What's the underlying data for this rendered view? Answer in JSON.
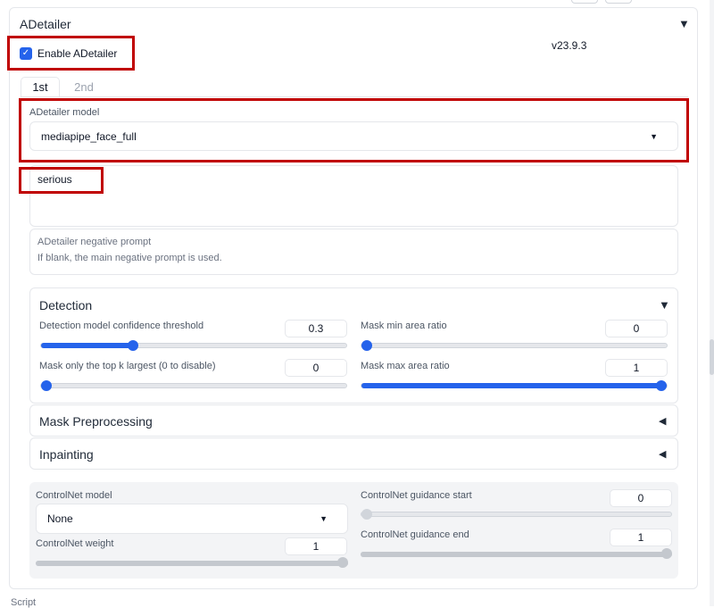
{
  "panel": {
    "title": "ADetailer",
    "version": "v23.9.3"
  },
  "enable": {
    "label": "Enable ADetailer",
    "checked": true
  },
  "tabs": [
    {
      "label": "1st",
      "active": true
    },
    {
      "label": "2nd",
      "active": false
    }
  ],
  "model": {
    "label": "ADetailer model",
    "value": "mediapipe_face_full"
  },
  "prompt": {
    "value": "serious"
  },
  "negative_prompt": {
    "placeholder_line1": "ADetailer negative prompt",
    "placeholder_line2": "If blank, the main negative prompt is used."
  },
  "detection": {
    "title": "Detection",
    "confidence": {
      "label": "Detection model confidence threshold",
      "value": "0.3",
      "fraction": 0.3
    },
    "topk": {
      "label": "Mask only the top k largest (0 to disable)",
      "value": "0",
      "fraction": 0
    },
    "min_area": {
      "label": "Mask min area ratio",
      "value": "0",
      "fraction": 0
    },
    "max_area": {
      "label": "Mask max area ratio",
      "value": "1",
      "fraction": 1
    }
  },
  "mask_preprocessing": {
    "title": "Mask Preprocessing"
  },
  "inpainting": {
    "title": "Inpainting"
  },
  "controlnet": {
    "model": {
      "label": "ControlNet model",
      "value": "None"
    },
    "weight": {
      "label": "ControlNet weight",
      "value": "1",
      "fraction": 1
    },
    "guidance_start": {
      "label": "ControlNet guidance start",
      "value": "0",
      "fraction": 0
    },
    "guidance_end": {
      "label": "ControlNet guidance end",
      "value": "1",
      "fraction": 1
    }
  },
  "footer": {
    "script_label": "Script"
  },
  "colors": {
    "accent": "#2563eb",
    "highlight": "#c00000"
  }
}
